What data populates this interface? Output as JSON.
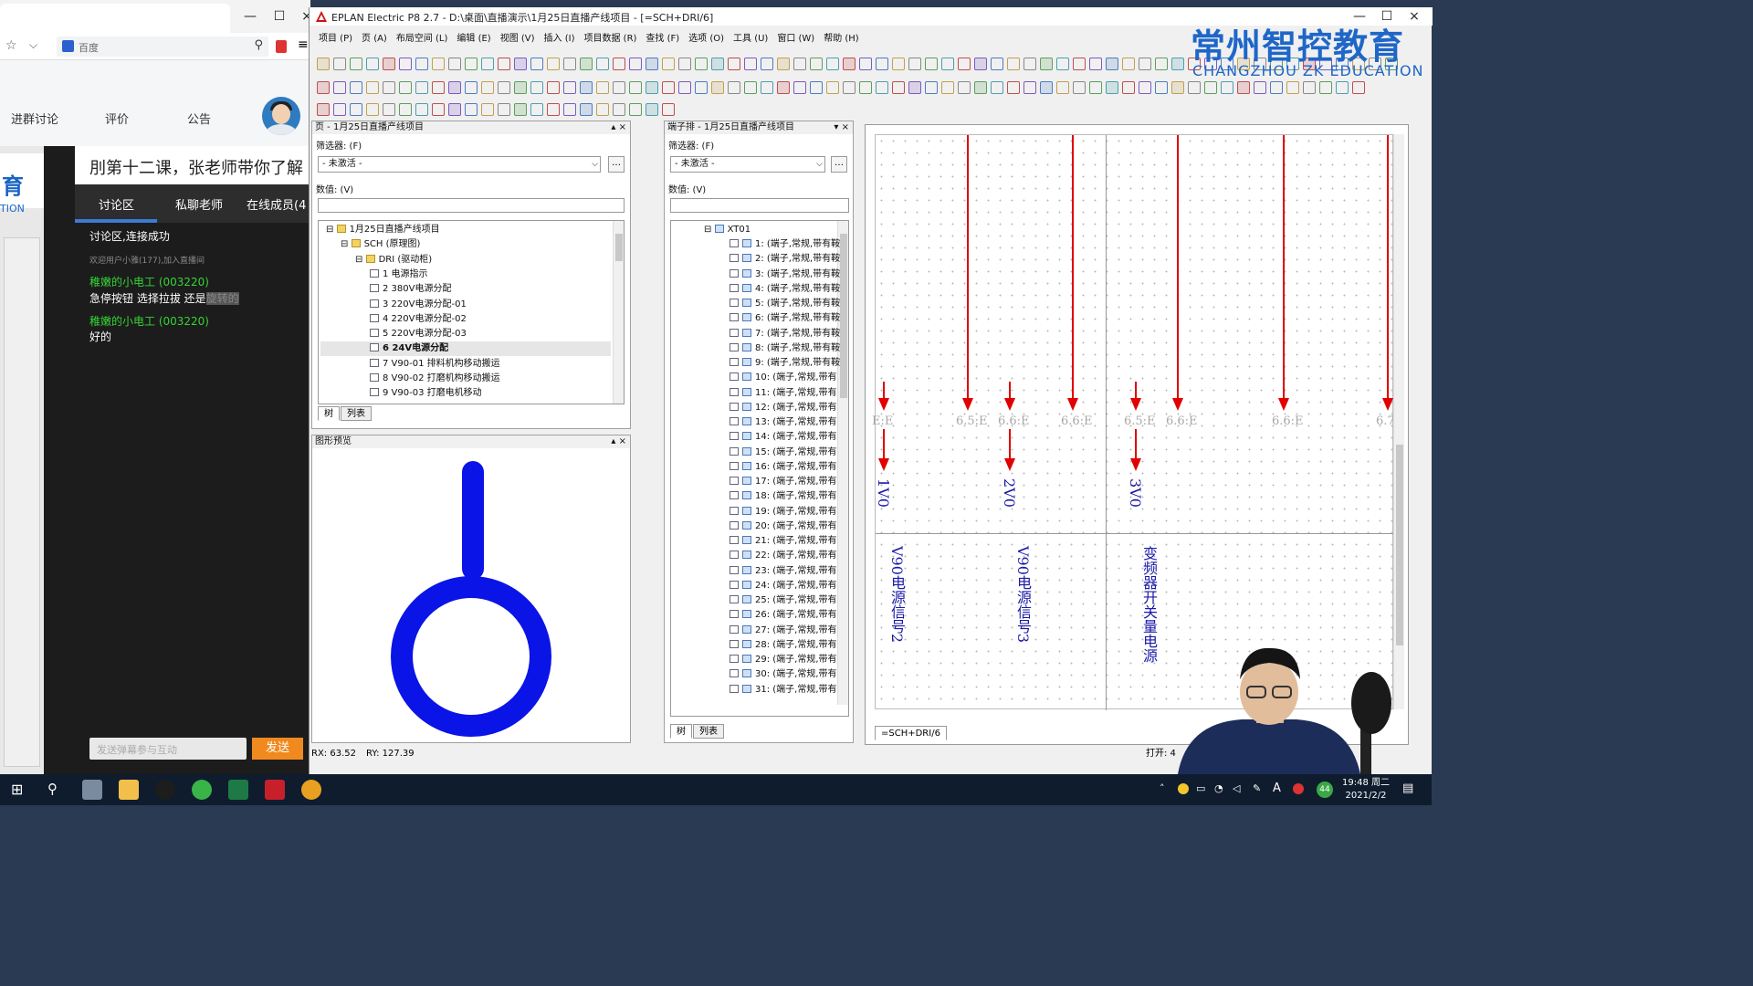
{
  "browser": {
    "search_text": "百度",
    "nav": [
      "进群讨论",
      "评价",
      "公告"
    ],
    "logo_chars": "育",
    "logo_sub": "TION",
    "banner": "刖第十二课，张老师带你了解",
    "tabs": [
      "讨论区",
      "私聊老师",
      "在线成员(4"
    ],
    "messages": [
      {
        "text": "讨论区,连接成功",
        "color": "#ffffff"
      },
      {
        "text": "欢迎用户小雅(177),加入直播间",
        "color": "#8a8a8a"
      },
      {
        "text": "稚嫩的小电工 (003220)",
        "color": "#35d435"
      },
      {
        "text": "急停按钮 选择拉拔 还是",
        "color": "#ffffff",
        "hl": "旋转的"
      },
      {
        "text": "稚嫩的小电工 (003220)",
        "color": "#35d435"
      },
      {
        "text": "好的",
        "color": "#ffffff"
      }
    ],
    "input_placeholder": "发送弹幕参与互动",
    "send_label": "发送"
  },
  "eplan": {
    "title": "EPLAN Electric P8 2.7 - D:\\桌面\\直播演示\\1月25日直播产线项目 - [=SCH+DRI/6]",
    "menu": [
      "项目 (P)",
      "页 (A)",
      "布局空间 (L)",
      "编辑 (E)",
      "视图 (V)",
      "插入 (I)",
      "项目数据 (R)",
      "查找 (F)",
      "选项 (O)",
      "工具 (U)",
      "窗口 (W)",
      "帮助 (H)"
    ],
    "page_panel": {
      "title": "页 - 1月25日直播产线项目",
      "filter_label": "筛选器: (F)",
      "filter_value": "- 未激活 -",
      "value_label": "数值: (V)",
      "tree": [
        {
          "text": "1月25日直播产线项目",
          "level": 0,
          "exp": "⊟"
        },
        {
          "text": "SCH (原理图)",
          "level": 1,
          "exp": "⊟"
        },
        {
          "text": "DRI (驱动柜)",
          "level": 2,
          "exp": "⊟"
        },
        {
          "text": "1 电源指示",
          "level": 3
        },
        {
          "text": "2 380V电源分配",
          "level": 3
        },
        {
          "text": "3 220V电源分配-01",
          "level": 3
        },
        {
          "text": "4 220V电源分配-02",
          "level": 3
        },
        {
          "text": "5 220V电源分配-03",
          "level": 3
        },
        {
          "text": "6 24V电源分配",
          "level": 3,
          "sel": true
        },
        {
          "text": "7 V90-01 排料机构移动搬运",
          "level": 3
        },
        {
          "text": "8 V90-02 打磨机构移动搬运",
          "level": 3
        },
        {
          "text": "9 V90-03 打磨电机移动",
          "level": 3
        }
      ],
      "tabs": [
        "树",
        "列表"
      ]
    },
    "preview_title": "图形预览",
    "terminal_panel": {
      "title": "端子排 - 1月25日直播产线项目",
      "filter_label": "筛选器: (F)",
      "filter_value": "- 未激活 -",
      "value_label": "数值: (V)",
      "root": "XT01",
      "terminals": [
        "1: (端子,常规,带有鞍",
        "2: (端子,常规,带有鞍",
        "3: (端子,常规,带有鞍",
        "4: (端子,常规,带有鞍",
        "5: (端子,常规,带有鞍",
        "6: (端子,常规,带有鞍",
        "7: (端子,常规,带有鞍",
        "8: (端子,常规,带有鞍",
        "9: (端子,常规,带有鞍",
        "10: (端子,常规,带有",
        "11: (端子,常规,带有",
        "12: (端子,常规,带有",
        "13: (端子,常规,带有",
        "14: (端子,常规,带有",
        "15: (端子,常规,带有",
        "16: (端子,常规,带有",
        "17: (端子,常规,带有",
        "18: (端子,常规,带有",
        "19: (端子,常规,带有",
        "20: (端子,常规,带有",
        "21: (端子,常规,带有",
        "22: (端子,常规,带有",
        "23: (端子,常规,带有",
        "24: (端子,常规,带有",
        "25: (端子,常规,带有",
        "26: (端子,常规,带有",
        "27: (端子,常规,带有",
        "28: (端子,常规,带有",
        "29: (端子,常规,带有",
        "30: (端子,常规,带有",
        "31: (端子,常规,带有"
      ],
      "tabs": [
        "树",
        "列表"
      ]
    },
    "canvas": {
      "xrefs": [
        "E:E",
        "6.5:E",
        "6.6:E",
        "6.6:E",
        "6.5:E",
        "6.6:E",
        "6.6:E",
        "6.7"
      ],
      "labels": [
        "1V0",
        "2V0",
        "3V0"
      ],
      "descs": [
        "V90电源信号2",
        "V90电源信号3",
        "变频器开关量电源"
      ],
      "tab": "=SCH+DRI/6"
    },
    "status": {
      "rx": "RX: 63.52",
      "ry": "RY: 127.39",
      "open": "打开: 4"
    }
  },
  "watermark": {
    "cn": "常州智控教育",
    "en": "CHANGZHOU ZK EDUCATION"
  },
  "taskbar": {
    "time": "19:48 周二",
    "date": "2021/2/2",
    "badge": "44"
  },
  "colors": {
    "accent": "#1f66c8",
    "wire": "#e00000",
    "symbol": "#0a14e6"
  }
}
